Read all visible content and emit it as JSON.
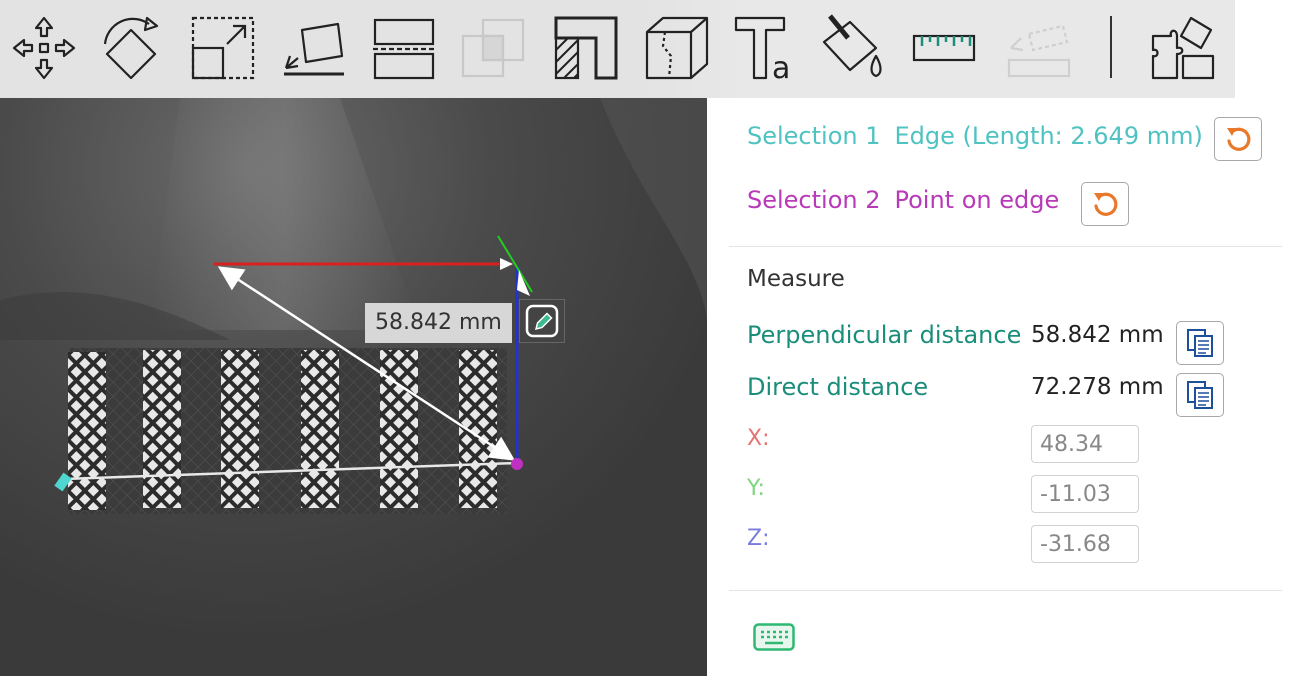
{
  "toolbar": {
    "tools": [
      {
        "name": "move-icon",
        "enabled": true
      },
      {
        "name": "rotate-icon",
        "enabled": true
      },
      {
        "name": "scale-icon",
        "enabled": true
      },
      {
        "name": "lay-on-face-icon",
        "enabled": true
      },
      {
        "name": "cut-icon",
        "enabled": true
      },
      {
        "name": "boolean-icon",
        "enabled": false
      },
      {
        "name": "support-paint-icon",
        "enabled": true
      },
      {
        "name": "seam-paint-icon",
        "enabled": true
      },
      {
        "name": "text-emboss-icon",
        "enabled": true
      },
      {
        "name": "color-paint-icon",
        "enabled": true
      },
      {
        "name": "measure-icon",
        "enabled": true
      },
      {
        "name": "assembly-icon",
        "enabled": false
      },
      {
        "name": "split-parts-icon",
        "enabled": true
      }
    ]
  },
  "viewport": {
    "distance_label": "58.842 mm"
  },
  "panel": {
    "selection1": {
      "label": "Selection 1",
      "value": "Edge (Length: 2.649 mm)"
    },
    "selection2": {
      "label": "Selection 2",
      "value": "Point on edge"
    },
    "measure_heading": "Measure",
    "perpendicular": {
      "label": "Perpendicular distance",
      "value": "58.842 mm"
    },
    "direct": {
      "label": "Direct distance",
      "value": "72.278 mm"
    },
    "x": {
      "label": "X:",
      "value": "48.34"
    },
    "y": {
      "label": "Y:",
      "value": "-11.03"
    },
    "z": {
      "label": "Z:",
      "value": "-31.68"
    }
  },
  "colors": {
    "selection1": "#4fc3c2",
    "selection2": "#b83ab8",
    "accent_green": "#1b8e7b",
    "reset_orange": "#e8782a",
    "axis_x": "#e57373",
    "axis_y": "#7ed67e",
    "axis_z": "#7b7be0"
  }
}
